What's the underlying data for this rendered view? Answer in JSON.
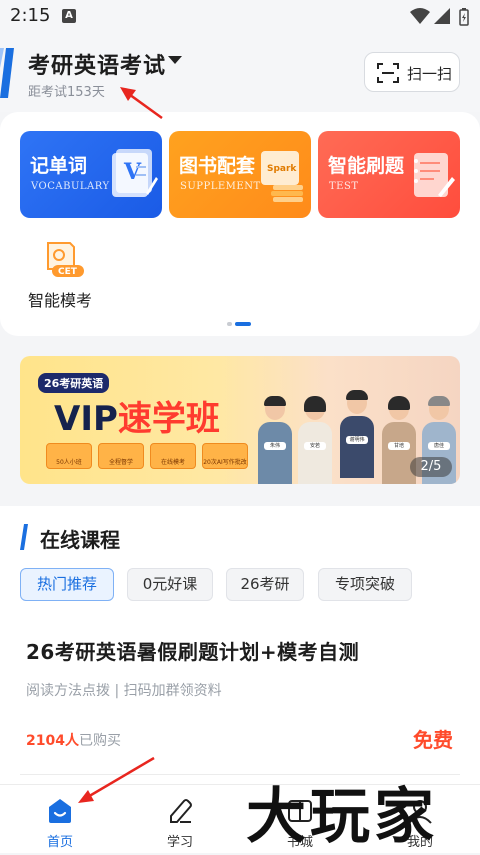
{
  "status_bar": {
    "time": "2:15",
    "notification_letter": "A",
    "icons": [
      "wifi-icon",
      "signal-icon",
      "battery-icon"
    ]
  },
  "header": {
    "exam_title": "考研英语考试",
    "countdown": "距考试153天",
    "scan_label": "扫一扫"
  },
  "features": {
    "tiles": [
      {
        "title": "记单词",
        "subtitle": "VOCABULARY",
        "color": "#2f74f5"
      },
      {
        "title": "图书配套",
        "subtitle": "SUPPLEMENT",
        "color": "#ffa21f"
      },
      {
        "title": "智能刷题",
        "subtitle": "TEST",
        "color": "#ff5a47"
      }
    ],
    "mock_exam": {
      "label": "智能模考",
      "badge": "CET"
    },
    "book_badge": "Spark"
  },
  "banner": {
    "tag": "26考研英语",
    "title_main": "VIP",
    "title_highlight": "速学班",
    "chips": [
      "50人小班",
      "全程督学",
      "在线模考",
      "20次AI写作批改"
    ],
    "teachers": [
      "朱伟",
      "安若",
      "谢明伟",
      "甘培",
      "唐佳"
    ],
    "page_indicator": "2/5"
  },
  "online_courses": {
    "section_title": "在线课程",
    "tabs": [
      {
        "label": "热门推荐",
        "active": true
      },
      {
        "label": "0元好课",
        "active": false
      },
      {
        "label": "26考研",
        "active": false
      },
      {
        "label": "专项突破",
        "active": false
      }
    ],
    "course": {
      "title": "26考研英语暑假刷题计划+模考自测",
      "subtitle": "阅读方法点拨 | 扫码加群领资料",
      "buyers_count": "2104人",
      "buyers_suffix": "已购买",
      "price": "免费"
    }
  },
  "bottom_nav": [
    {
      "label": "首页",
      "icon": "home-icon",
      "active": true
    },
    {
      "label": "学习",
      "icon": "study-icon",
      "active": false
    },
    {
      "label": "书城",
      "icon": "bookstore-icon",
      "active": false
    },
    {
      "label": "我的",
      "icon": "profile-icon",
      "active": false
    }
  ],
  "watermark": "大玩家",
  "colors": {
    "accent_blue": "#1a6fe0",
    "price_red": "#ff4b2b",
    "annotation_red": "#e8261f"
  }
}
